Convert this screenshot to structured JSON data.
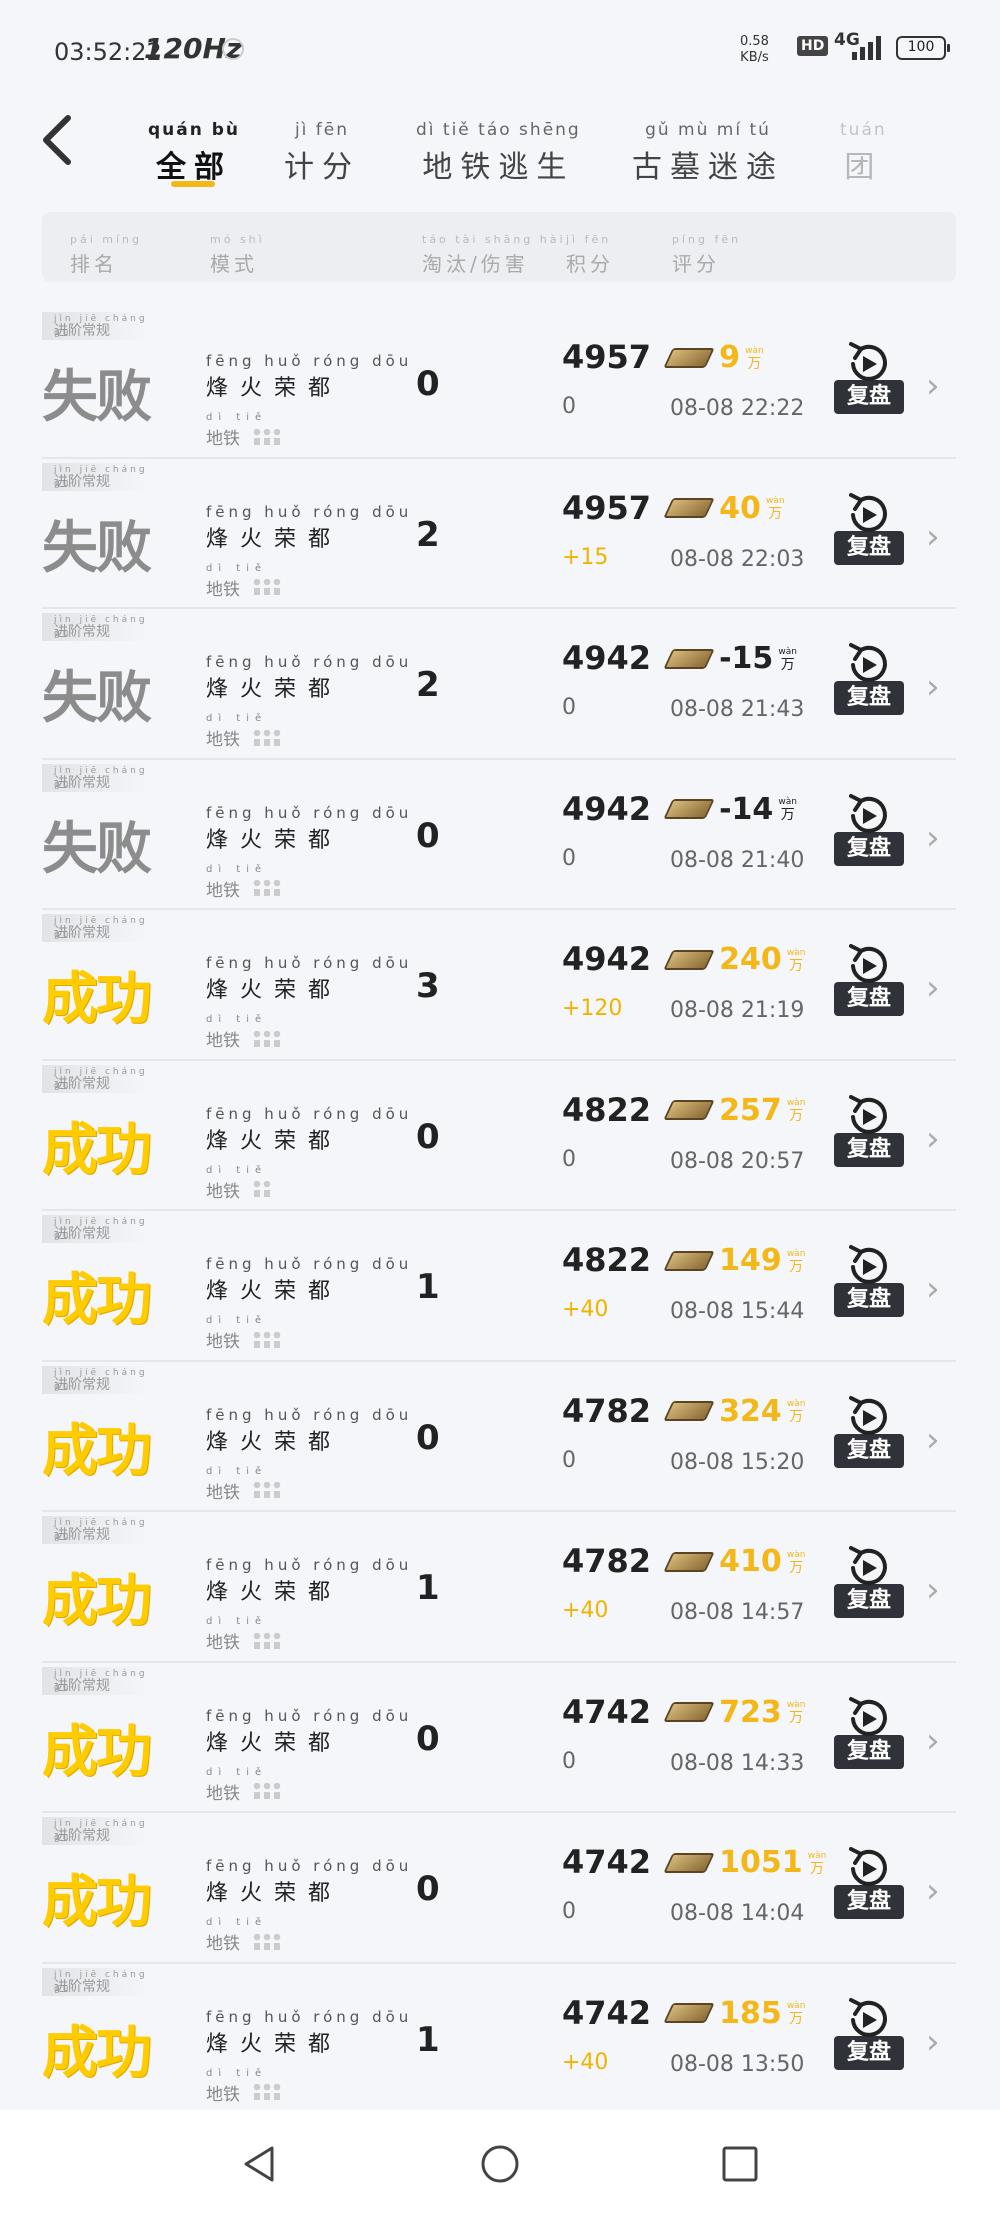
{
  "status": {
    "time": "03:52:22",
    "refresh": "120Hz",
    "speed_value": "0.58",
    "speed_unit": "KB/s",
    "hd": "HD",
    "network": "4G",
    "battery": "100"
  },
  "tabs": [
    {
      "pinyin": "quán bù",
      "label": "全部",
      "active": true
    },
    {
      "pinyin": "jì fēn",
      "label": "计分",
      "active": false
    },
    {
      "pinyin": "dì tiě táo shēng",
      "label": "地铁逃生",
      "active": false
    },
    {
      "pinyin": "gǔ mù mí tú",
      "label": "古墓迷途",
      "active": false
    },
    {
      "pinyin": "tuán",
      "label": "团",
      "active": false
    }
  ],
  "header": {
    "rank": {
      "pinyin": "pái míng",
      "label": "排名"
    },
    "mode": {
      "pinyin": "mó shì",
      "label": "模式"
    },
    "elim": {
      "pinyin": "táo tài shāng hài",
      "label": "淘汰/伤害"
    },
    "score": {
      "pinyin": "jì fēn",
      "label": "积分"
    },
    "rating": {
      "pinyin": "píng fēn",
      "label": "评分"
    }
  },
  "row_common": {
    "tag_pinyin": "jìn jiē cháng guī",
    "tag": "进阶常规",
    "mode_pinyin": "fēng huǒ róng dōu",
    "mode": "烽火荣都",
    "map_pinyin": "dì tiě",
    "map": "地铁",
    "replay": "复盘",
    "wan_pinyin": "wàn",
    "wan": "万"
  },
  "rows": [
    {
      "result": "失败",
      "win": false,
      "elim": "0",
      "score": "4957",
      "delta": "0",
      "rating": "9",
      "time": "08-08 22:22",
      "squad": 3
    },
    {
      "result": "失败",
      "win": false,
      "elim": "2",
      "score": "4957",
      "delta": "+15",
      "rating": "40",
      "time": "08-08 22:03",
      "squad": 3
    },
    {
      "result": "失败",
      "win": false,
      "elim": "2",
      "score": "4942",
      "delta": "0",
      "rating": "-15",
      "time": "08-08 21:43",
      "squad": 3
    },
    {
      "result": "失败",
      "win": false,
      "elim": "0",
      "score": "4942",
      "delta": "0",
      "rating": "-14",
      "time": "08-08 21:40",
      "squad": 3
    },
    {
      "result": "成功",
      "win": true,
      "elim": "3",
      "score": "4942",
      "delta": "+120",
      "rating": "240",
      "time": "08-08 21:19",
      "squad": 3
    },
    {
      "result": "成功",
      "win": true,
      "elim": "0",
      "score": "4822",
      "delta": "0",
      "rating": "257",
      "time": "08-08 20:57",
      "squad": 2
    },
    {
      "result": "成功",
      "win": true,
      "elim": "1",
      "score": "4822",
      "delta": "+40",
      "rating": "149",
      "time": "08-08 15:44",
      "squad": 3
    },
    {
      "result": "成功",
      "win": true,
      "elim": "0",
      "score": "4782",
      "delta": "0",
      "rating": "324",
      "time": "08-08 15:20",
      "squad": 3
    },
    {
      "result": "成功",
      "win": true,
      "elim": "1",
      "score": "4782",
      "delta": "+40",
      "rating": "410",
      "time": "08-08 14:57",
      "squad": 3
    },
    {
      "result": "成功",
      "win": true,
      "elim": "0",
      "score": "4742",
      "delta": "0",
      "rating": "723",
      "time": "08-08 14:33",
      "squad": 3
    },
    {
      "result": "成功",
      "win": true,
      "elim": "0",
      "score": "4742",
      "delta": "0",
      "rating": "1051",
      "time": "08-08 14:04",
      "squad": 3
    },
    {
      "result": "成功",
      "win": true,
      "elim": "1",
      "score": "4742",
      "delta": "+40",
      "rating": "185",
      "time": "08-08 13:50",
      "squad": 3
    }
  ],
  "colors": {
    "accent": "#f3b71a",
    "win": "#ffcc00",
    "fail": "#8c8c8c",
    "replay_bg": "#2f3238"
  }
}
